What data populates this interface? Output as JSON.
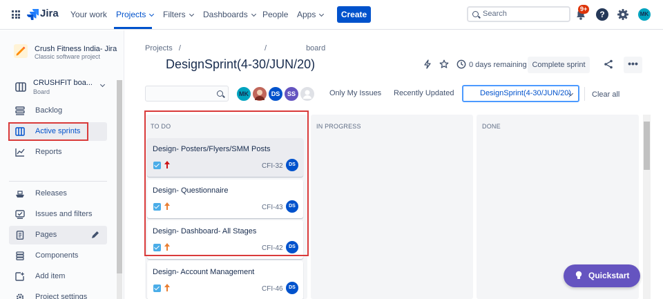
{
  "topnav": {
    "logo_text": "Jira",
    "items": [
      "Your work",
      "Projects",
      "Filters",
      "Dashboards",
      "People",
      "Apps"
    ],
    "create_label": "Create",
    "search_placeholder": "Search",
    "notifications_badge": "9+",
    "help_glyph": "?",
    "user_initials": "MK"
  },
  "sidebar": {
    "project_name": "Crush Fitness India- Jira",
    "project_type": "Classic software project",
    "board_label": "CRUSHFIT boa...",
    "board_sub": "Board",
    "items": [
      "Backlog",
      "Active sprints",
      "Reports",
      "Releases",
      "Issues and filters",
      "Pages",
      "Components",
      "Add item",
      "Project settings"
    ],
    "selected": "Active sprints"
  },
  "main": {
    "breadcrumb": {
      "projects": "Projects",
      "sep": "/",
      "board": "board"
    },
    "title": "DesignSprint(4-30/JUN/20)",
    "days_remaining": "0 days remaining",
    "complete_label": "Complete sprint",
    "more_label": "•••",
    "avatars": [
      {
        "initials": "MK",
        "color": "#00a3bf"
      },
      {
        "initials": "",
        "color": "#c1675b"
      },
      {
        "initials": "DS",
        "color": "#0052cc"
      },
      {
        "initials": "SS",
        "color": "#6554c0"
      },
      {
        "initials": "",
        "color": "#dfe1e6"
      }
    ],
    "filters": {
      "only_my_issues": "Only My Issues",
      "recently_updated": "Recently Updated"
    },
    "sprint_select": "DesignSprint(4-30/JUN/20)",
    "clear_all": "Clear all"
  },
  "board": {
    "columns": [
      {
        "title": "TO DO",
        "cards": [
          {
            "summary": "Design- Posters/Flyers/SMM Posts",
            "key": "CFI-32",
            "assignee": "DS",
            "priority": "high",
            "priority_color": "#cd1316"
          },
          {
            "summary": "Design- Questionnaire",
            "key": "CFI-43",
            "assignee": "DS",
            "priority": "medium",
            "priority_color": "#e97f33"
          },
          {
            "summary": "Design- Dashboard- All Stages",
            "key": "CFI-42",
            "assignee": "DS",
            "priority": "medium",
            "priority_color": "#e97f33"
          },
          {
            "summary": "Design- Account Management",
            "key": "CFI-46",
            "assignee": "DS",
            "priority": "medium",
            "priority_color": "#e97f33"
          }
        ]
      },
      {
        "title": "IN PROGRESS",
        "cards": []
      },
      {
        "title": "DONE",
        "cards": []
      }
    ]
  },
  "quickstart": {
    "label": "Quickstart"
  },
  "colors": {
    "brand": "#0052cc",
    "quickstart": "#6554c0",
    "highlight_box": "#d93a3a"
  }
}
